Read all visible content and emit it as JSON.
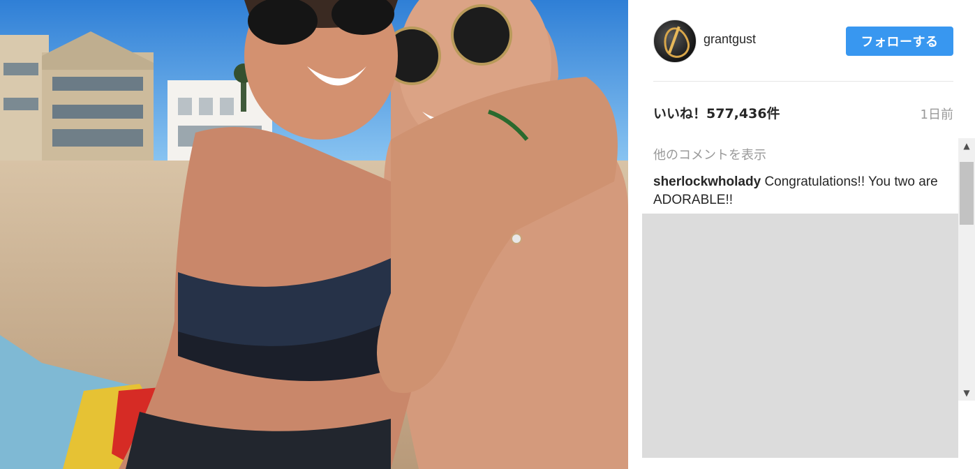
{
  "post": {
    "image_alt": "Couple embracing on a sunny beach"
  },
  "header": {
    "username": "grantgust",
    "follow_label": "フォローする"
  },
  "stats": {
    "likes": "いいね！577,436件",
    "time": "1日前"
  },
  "comments": {
    "more_label": "他のコメントを表示",
    "items": [
      {
        "author": "sherlockwholady",
        "text": "Congratulations!! You two are ADORABLE!!"
      }
    ]
  },
  "scrollbar": {
    "up_icon": "▲",
    "down_icon": "▼"
  },
  "colors": {
    "accent": "#3897f0",
    "text": "#262626",
    "muted": "#999999"
  }
}
